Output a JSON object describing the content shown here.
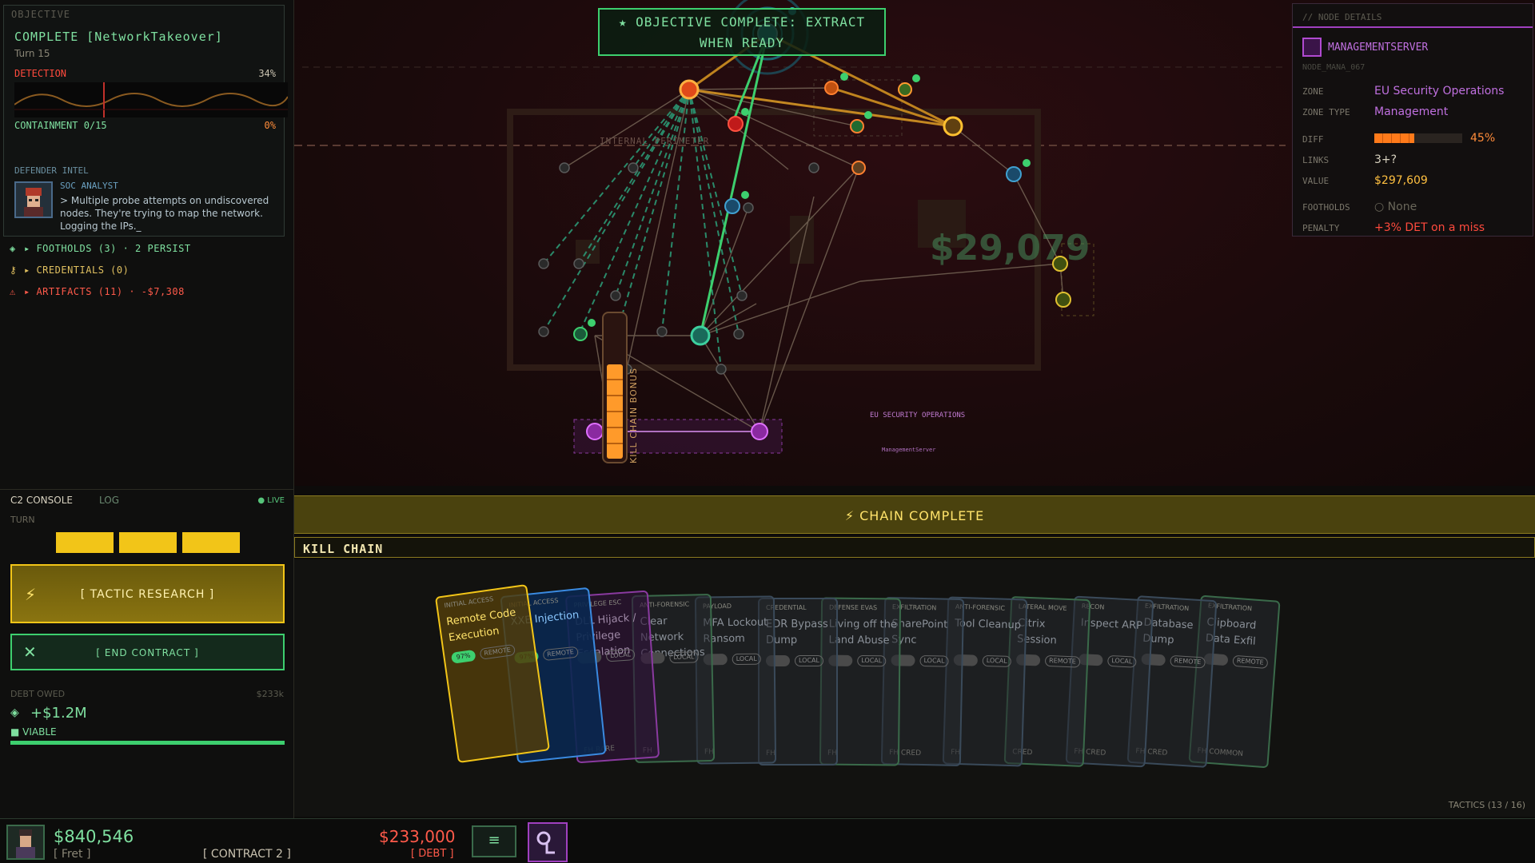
{
  "left": {
    "objective_label": "OBJECTIVE",
    "objective_status": "COMPLETE  [NetworkTakeover]",
    "turn": "Turn 15",
    "detection_label": "DETECTION",
    "detection_pct": "34%",
    "containment_label": "CONTAINMENT  0/15",
    "containment_pct": "0%",
    "intel_label": "DEFENDER INTEL",
    "intel_role": "SOC ANALYST",
    "intel_message": "> Multiple probe attempts on undiscovered nodes. They're trying to map the network. Logging the IPs._",
    "footholds": "▸ FOOTHOLDS  (3)  ·  2 PERSIST",
    "credentials": "▸ CREDENTIALS  (0)",
    "artifacts": "▸ ARTIFACTS  (11)  ·  -$7,308",
    "c2_tab": "C2 CONSOLE",
    "log_tab": "LOG",
    "live": "● LIVE",
    "turn_label": "TURN",
    "tactic_button": "[ TACTIC RESEARCH ]",
    "end_button": "[ END CONTRACT ]",
    "debt_owed_label": "DEBT OWED",
    "debt_owed_amount": "$233k",
    "debt_value": "+$1.2M",
    "viable": "■ VIABLE"
  },
  "map": {
    "objective_banner_line1": "★ OBJECTIVE COMPLETE: EXTRACT",
    "objective_banner_line2": "WHEN READY",
    "perimeter_label": "INTERNAL PERIMETER",
    "network_value": "$29,079",
    "zone_label": "EU SECURITY OPERATIONS",
    "node_sub_label": "ManagementServer",
    "kill_chain_bonus": "KILL CHAIN BONUS"
  },
  "node_details": {
    "header": "// NODE DETAILS",
    "name": "MANAGEMENTSERVER",
    "id": "NODE_MANA_067",
    "zone_key": "ZONE",
    "zone": "EU Security Operations",
    "zone_type_key": "ZONE TYPE",
    "zone_type": "Management",
    "diff_key": "DIFF",
    "diff_pct": "45%",
    "difficulty": 0.45,
    "links_key": "LINKS",
    "links": "3+?",
    "value_key": "VALUE",
    "value": "$297,609",
    "footholds_key": "FOOTHOLDS",
    "footholds": "○ None",
    "penalty_key": "PENALTY",
    "penalty": "+3% DET on a miss"
  },
  "kill_chain": {
    "chain_complete": "⚡  CHAIN COMPLETE",
    "label": "KILL CHAIN",
    "tactics_count": "TACTICS (13 / 16)",
    "cards": [
      {
        "cat": "INITIAL ACCESS",
        "title": "Remote Code Execution",
        "tag": "97%",
        "tag2": "REMOTE",
        "foot": ""
      },
      {
        "cat": "INITIAL ACCESS",
        "title": "XXE Injection",
        "tag": "97%",
        "tag2": "REMOTE",
        "foot": ""
      },
      {
        "cat": "PRIVILEGE ESC",
        "title": "DLL Hijack / Privilege Escalation",
        "tag": "",
        "tag2": "LOCAL",
        "foot": "FH  RARE"
      },
      {
        "cat": "ANTI-FORENSIC",
        "title": "Clear Network Connections",
        "tag": "",
        "tag2": "LOCAL",
        "foot": "FH"
      },
      {
        "cat": "PAYLOAD",
        "title": "MFA Lockout Ransom",
        "tag": "",
        "tag2": "LOCAL",
        "foot": "FH"
      },
      {
        "cat": "CREDENTIAL",
        "title": "EDR Bypass Dump",
        "tag": "",
        "tag2": "LOCAL",
        "foot": "FH"
      },
      {
        "cat": "DEFENSE EVAS",
        "title": "Living off the Land Abuse",
        "tag": "",
        "tag2": "LOCAL",
        "foot": "FH"
      },
      {
        "cat": "EXFILTRATION",
        "title": "SharePoint Sync",
        "tag": "",
        "tag2": "LOCAL",
        "foot": "FH  CRED"
      },
      {
        "cat": "ANTI-FORENSIC",
        "title": "Tool Cleanup",
        "tag": "",
        "tag2": "LOCAL",
        "foot": "FH"
      },
      {
        "cat": "LATERAL MOVE",
        "title": "Citrix Session",
        "tag": "",
        "tag2": "REMOTE",
        "foot": "CRED"
      },
      {
        "cat": "RECON",
        "title": "Inspect ARP",
        "tag": "",
        "tag2": "LOCAL",
        "foot": "FH  CRED"
      },
      {
        "cat": "EXFILTRATION",
        "title": "Database Dump",
        "tag": "",
        "tag2": "REMOTE",
        "foot": "FH  CRED"
      },
      {
        "cat": "EXFILTRATION",
        "title": "Clipboard Data Exfil",
        "tag": "",
        "tag2": "REMOTE",
        "foot": "FH   COMMON"
      }
    ]
  },
  "status": {
    "money": "$840,546",
    "player": "[ Fret ]",
    "contract": "[ CONTRACT 2 ]",
    "debt": "$233,000",
    "debt_tag": "[ DEBT ]",
    "menu_icon": "≡"
  },
  "colors": {
    "accent_green": "#3dcf6e",
    "accent_yellow": "#f2c518",
    "danger_red": "#ff4a3d",
    "management_purple": "#b04ad0"
  }
}
